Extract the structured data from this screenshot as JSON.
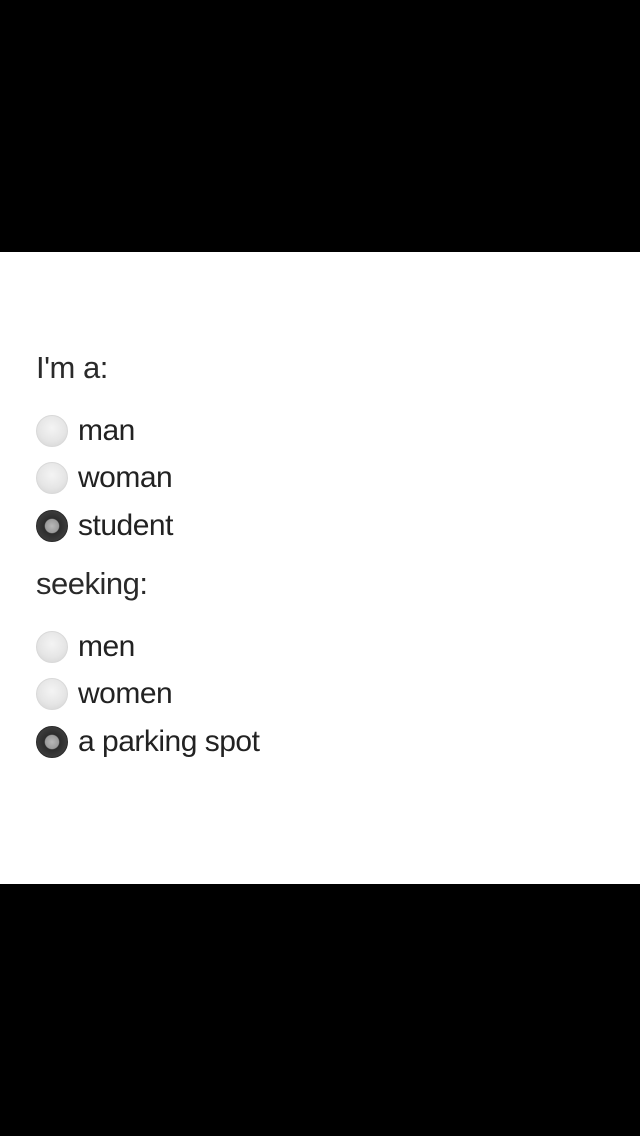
{
  "form": {
    "iam": {
      "label": "I'm a:",
      "options": [
        {
          "label": "man",
          "selected": false
        },
        {
          "label": "woman",
          "selected": false
        },
        {
          "label": "student",
          "selected": true
        }
      ]
    },
    "seeking": {
      "label": "seeking:",
      "options": [
        {
          "label": "men",
          "selected": false
        },
        {
          "label": "women",
          "selected": false
        },
        {
          "label": "a parking spot",
          "selected": true
        }
      ]
    }
  },
  "icons": {
    "radio_unselected": "radio-unselected-icon",
    "radio_selected": "radio-selected-icon"
  },
  "colors": {
    "background": "#ffffff",
    "frame": "#000000",
    "text": "#222222"
  }
}
